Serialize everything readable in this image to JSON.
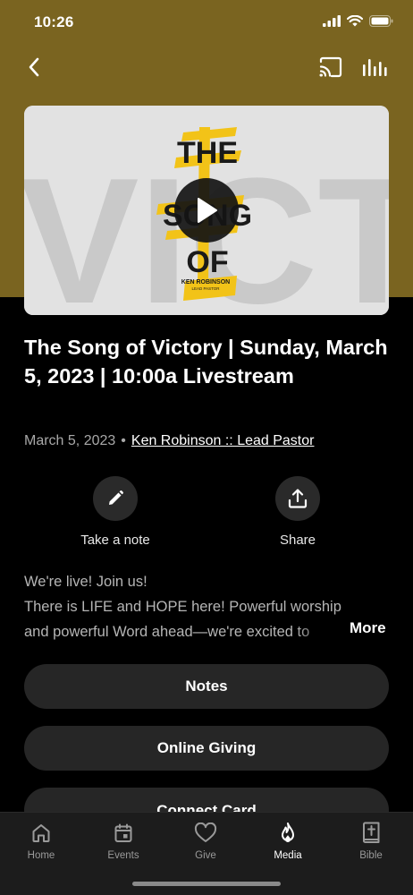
{
  "status_bar": {
    "time": "10:26"
  },
  "header": {
    "band_color": "#7a6420"
  },
  "media": {
    "artwork_title": [
      "THE",
      "SONG",
      "OF"
    ],
    "artwork_overlay": "VICTORY",
    "artwork_author": "KEN ROBINSON",
    "artwork_subtitle": "LEAD PASTOR",
    "accent_color": "#f2c318"
  },
  "sermon": {
    "title": "The Song of Victory | Sunday, March 5, 2023 | 10:00a Livestream",
    "date": "March 5, 2023",
    "separator": "•",
    "author": "Ken Robinson :: Lead Pastor"
  },
  "actions": {
    "note_label": "Take a note",
    "share_label": "Share"
  },
  "description": {
    "line1": "We're live! Join us!",
    "line2": "There is LIFE and HOPE here! Powerful worship",
    "line3": "and powerful Word ahead—we're excited to",
    "more_label": "More"
  },
  "buttons": {
    "notes": "Notes",
    "giving": "Online Giving",
    "connect": "Connect Card"
  },
  "tabs": [
    {
      "label": "Home",
      "icon": "home-icon"
    },
    {
      "label": "Events",
      "icon": "calendar-icon"
    },
    {
      "label": "Give",
      "icon": "heart-icon"
    },
    {
      "label": "Media",
      "icon": "flame-icon",
      "active": true
    },
    {
      "label": "Bible",
      "icon": "bible-icon"
    }
  ]
}
